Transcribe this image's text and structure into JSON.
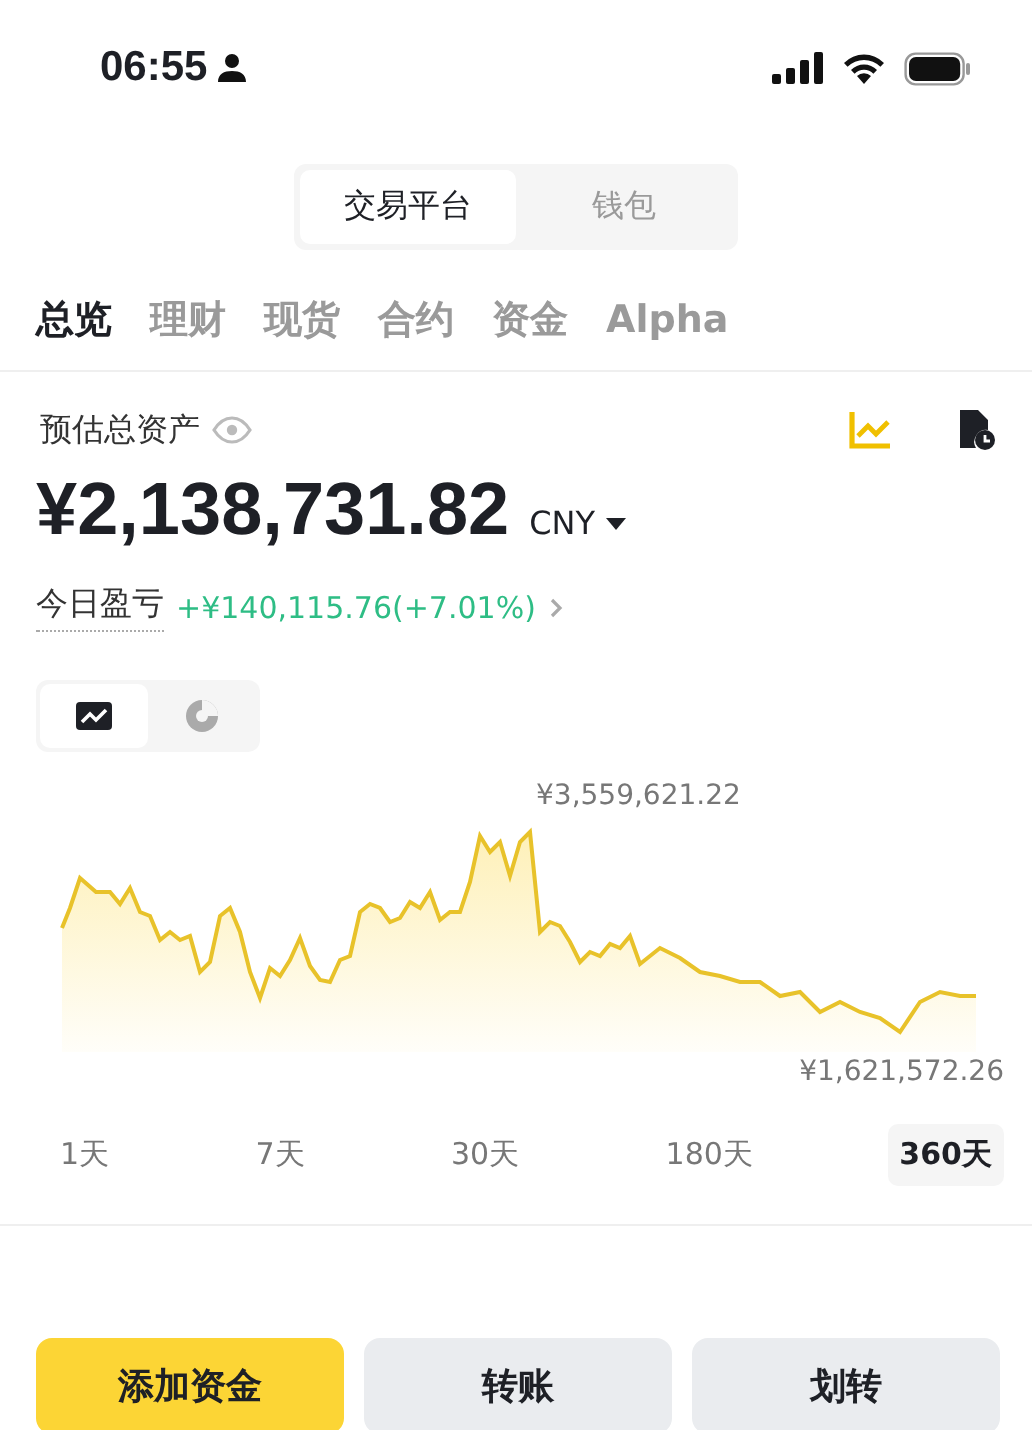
{
  "status_bar": {
    "time": "06:55"
  },
  "segments": [
    {
      "label": "交易平台",
      "selected": true
    },
    {
      "label": "钱包",
      "selected": false
    }
  ],
  "tabs": [
    {
      "label": "总览",
      "selected": true
    },
    {
      "label": "理财",
      "selected": false
    },
    {
      "label": "现货",
      "selected": false
    },
    {
      "label": "合约",
      "selected": false
    },
    {
      "label": "资金",
      "selected": false
    },
    {
      "label": "Alpha",
      "selected": false
    }
  ],
  "balance": {
    "label": "预估总资产",
    "amount": "¥2,138,731.82",
    "currency": "CNY"
  },
  "pnl": {
    "label": "今日盈亏",
    "value": "+¥140,115.76(+7.01%)"
  },
  "chart_views": [
    {
      "kind": "line",
      "selected": true
    },
    {
      "kind": "pie",
      "selected": false
    }
  ],
  "chart": {
    "max_label": "¥3,559,621.22",
    "min_label": "¥1,621,572.26"
  },
  "periods": [
    {
      "label": "1天",
      "selected": false
    },
    {
      "label": "7天",
      "selected": false
    },
    {
      "label": "30天",
      "selected": false
    },
    {
      "label": "180天",
      "selected": false
    },
    {
      "label": "360天",
      "selected": true
    }
  ],
  "actions": [
    {
      "label": "添加资金",
      "kind": "primary"
    },
    {
      "label": "转账",
      "kind": "secondary"
    },
    {
      "label": "划转",
      "kind": "secondary"
    }
  ]
}
